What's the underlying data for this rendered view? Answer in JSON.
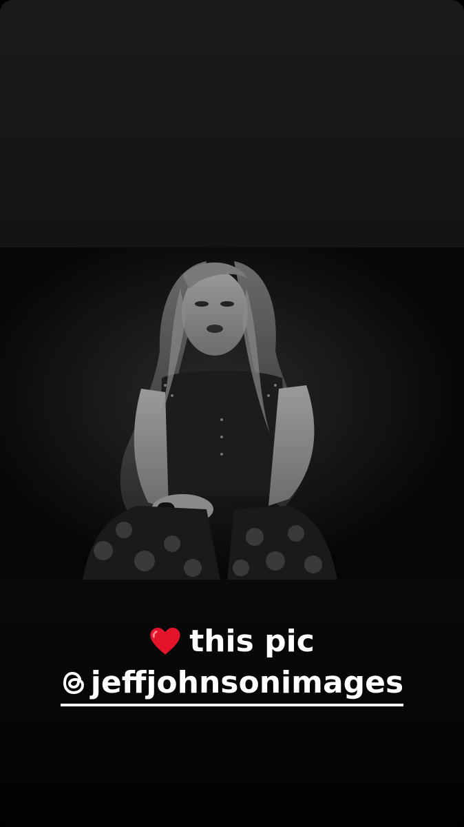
{
  "story": {
    "caption": {
      "heart_icon": "red-heart-emoji",
      "text": "this pic",
      "mention_icon": "threads-icon",
      "mention": "jeffjohnsonimages"
    },
    "photo": {
      "description_icon": "black-and-white-performer-photo"
    }
  }
}
